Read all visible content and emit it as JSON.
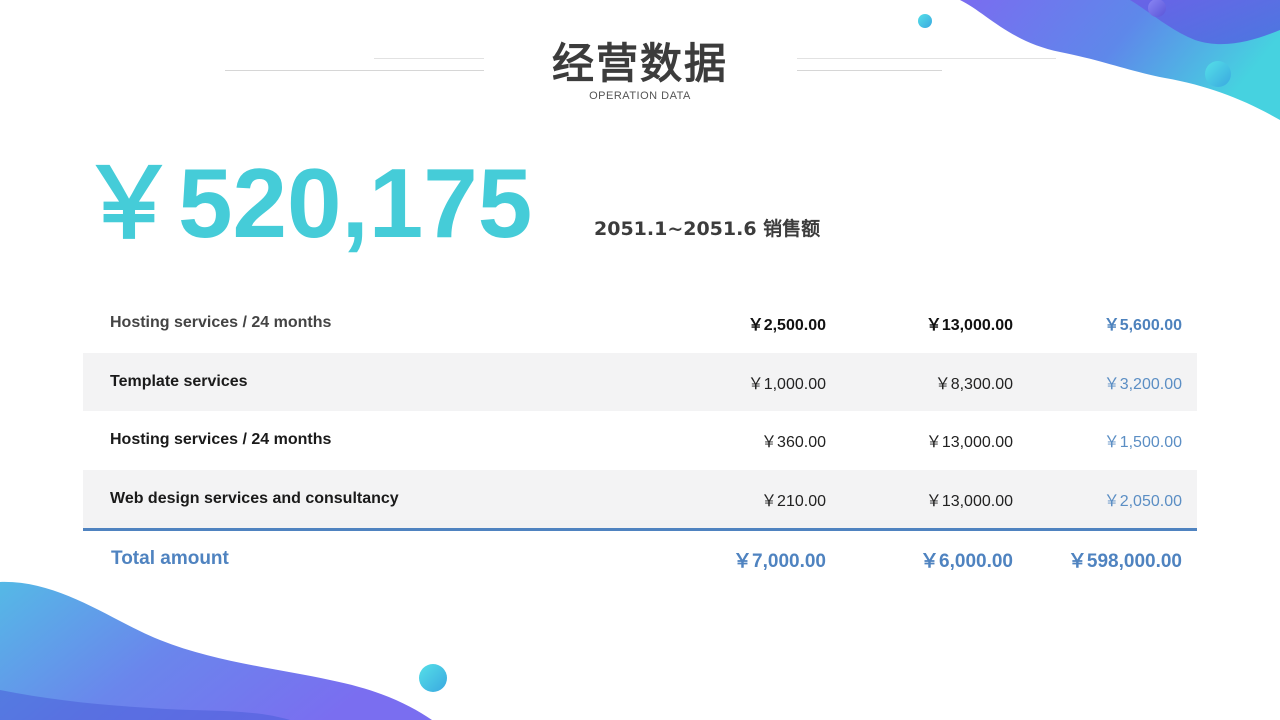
{
  "title": "经营数据",
  "subtitle": "OPERATION DATA",
  "headline": {
    "amount": "￥520,175",
    "label": "2051.1~2051.6 销售额"
  },
  "table": {
    "rows": [
      {
        "name": "Hosting services / 24 months",
        "v1": "￥2,500.00",
        "v2": "￥13,000.00",
        "v3": "￥5,600.00"
      },
      {
        "name": "Template services",
        "v1": "￥1,000.00",
        "v2": "￥8,300.00",
        "v3": "￥3,200.00"
      },
      {
        "name": "Hosting services / 24 months",
        "v1": "￥360.00",
        "v2": "￥13,000.00",
        "v3": "￥1,500.00"
      },
      {
        "name": "Web design services and consultancy",
        "v1": "￥210.00",
        "v2": "￥13,000.00",
        "v3": "￥2,050.00"
      }
    ],
    "total": {
      "name": "Total amount",
      "v1": "￥7,000.00",
      "v2": "￥6,000.00",
      "v3": "￥598,000.00"
    }
  },
  "colors": {
    "accent_cyan": "#45ccd8",
    "accent_blue": "#4f83c0",
    "wave_start": "#5b7fe8",
    "wave_end": "#45d6e0"
  }
}
